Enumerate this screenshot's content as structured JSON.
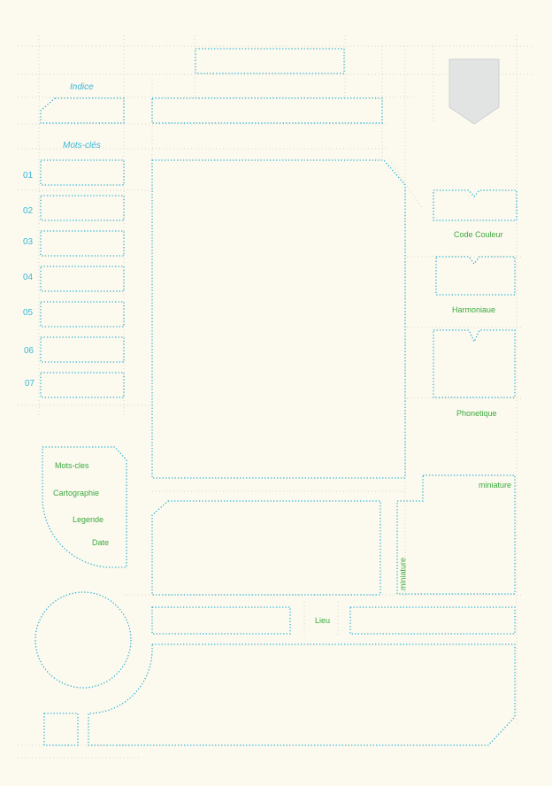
{
  "colors": {
    "background": "#fcfaee",
    "dotted_outline": "#2bb0d6",
    "label_blue": "#3ab6d8",
    "label_green": "#3aa83f",
    "guide": "#d6d6c8",
    "shield": "#e2e3e3"
  },
  "labels": {
    "indice": "Indice",
    "mots_cles_title": "Mots-clés",
    "code_couleur": "Code Couleur",
    "harmonique": "Harmoniaue",
    "phonetique": "Phonetique",
    "miniature_top": "miniature",
    "miniature_side": "miniature",
    "lieu": "Lieu"
  },
  "numbers": [
    "01",
    "02",
    "03",
    "04",
    "05",
    "06",
    "07"
  ],
  "legend_list": [
    "Mots-cles",
    "Cartographie",
    "Legende",
    "Date"
  ],
  "icons": {
    "shield": "shield-icon",
    "circle": "circle-placeholder-icon"
  }
}
